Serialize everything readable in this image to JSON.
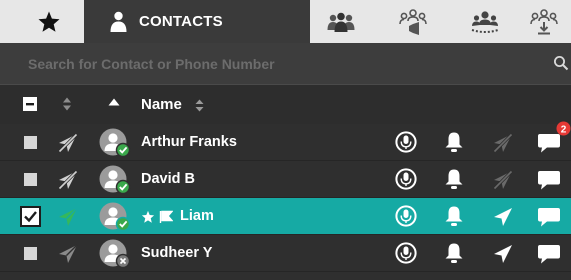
{
  "tabs": {
    "contacts_label": "CONTACTS"
  },
  "search": {
    "placeholder": "Search for Contact or Phone Number"
  },
  "header": {
    "name_label": "Name"
  },
  "contacts": [
    {
      "name": "Arthur Franks",
      "selected": false,
      "status": "online",
      "badge": "2"
    },
    {
      "name": "David B",
      "selected": false,
      "status": "online",
      "badge": ""
    },
    {
      "name": "Liam",
      "selected": true,
      "status": "online",
      "badge": ""
    },
    {
      "name": "Sudheer Y",
      "selected": false,
      "status": "offline",
      "badge": ""
    }
  ],
  "colors": {
    "tab_bar": "#e7e7e7",
    "dark_bg": "#2f2f2f",
    "selected_row": "#16aaa4",
    "online_status": "#3aa84b",
    "badge": "#e53935"
  }
}
